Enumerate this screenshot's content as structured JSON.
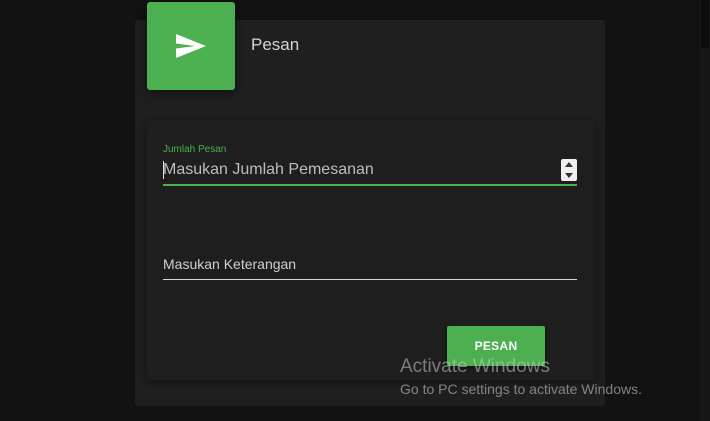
{
  "card": {
    "title": "Pesan",
    "icon": "send-icon",
    "accent_color": "#4caf50"
  },
  "form": {
    "quantity": {
      "label": "Jumlah Pesan",
      "placeholder": "Masukan Jumlah Pemesanan",
      "value": ""
    },
    "note": {
      "placeholder": "Masukan Keterangan",
      "value": ""
    },
    "submit_label": "PESAN"
  },
  "watermark": {
    "title": "Activate Windows",
    "subtitle": "Go to PC settings to activate Windows."
  }
}
